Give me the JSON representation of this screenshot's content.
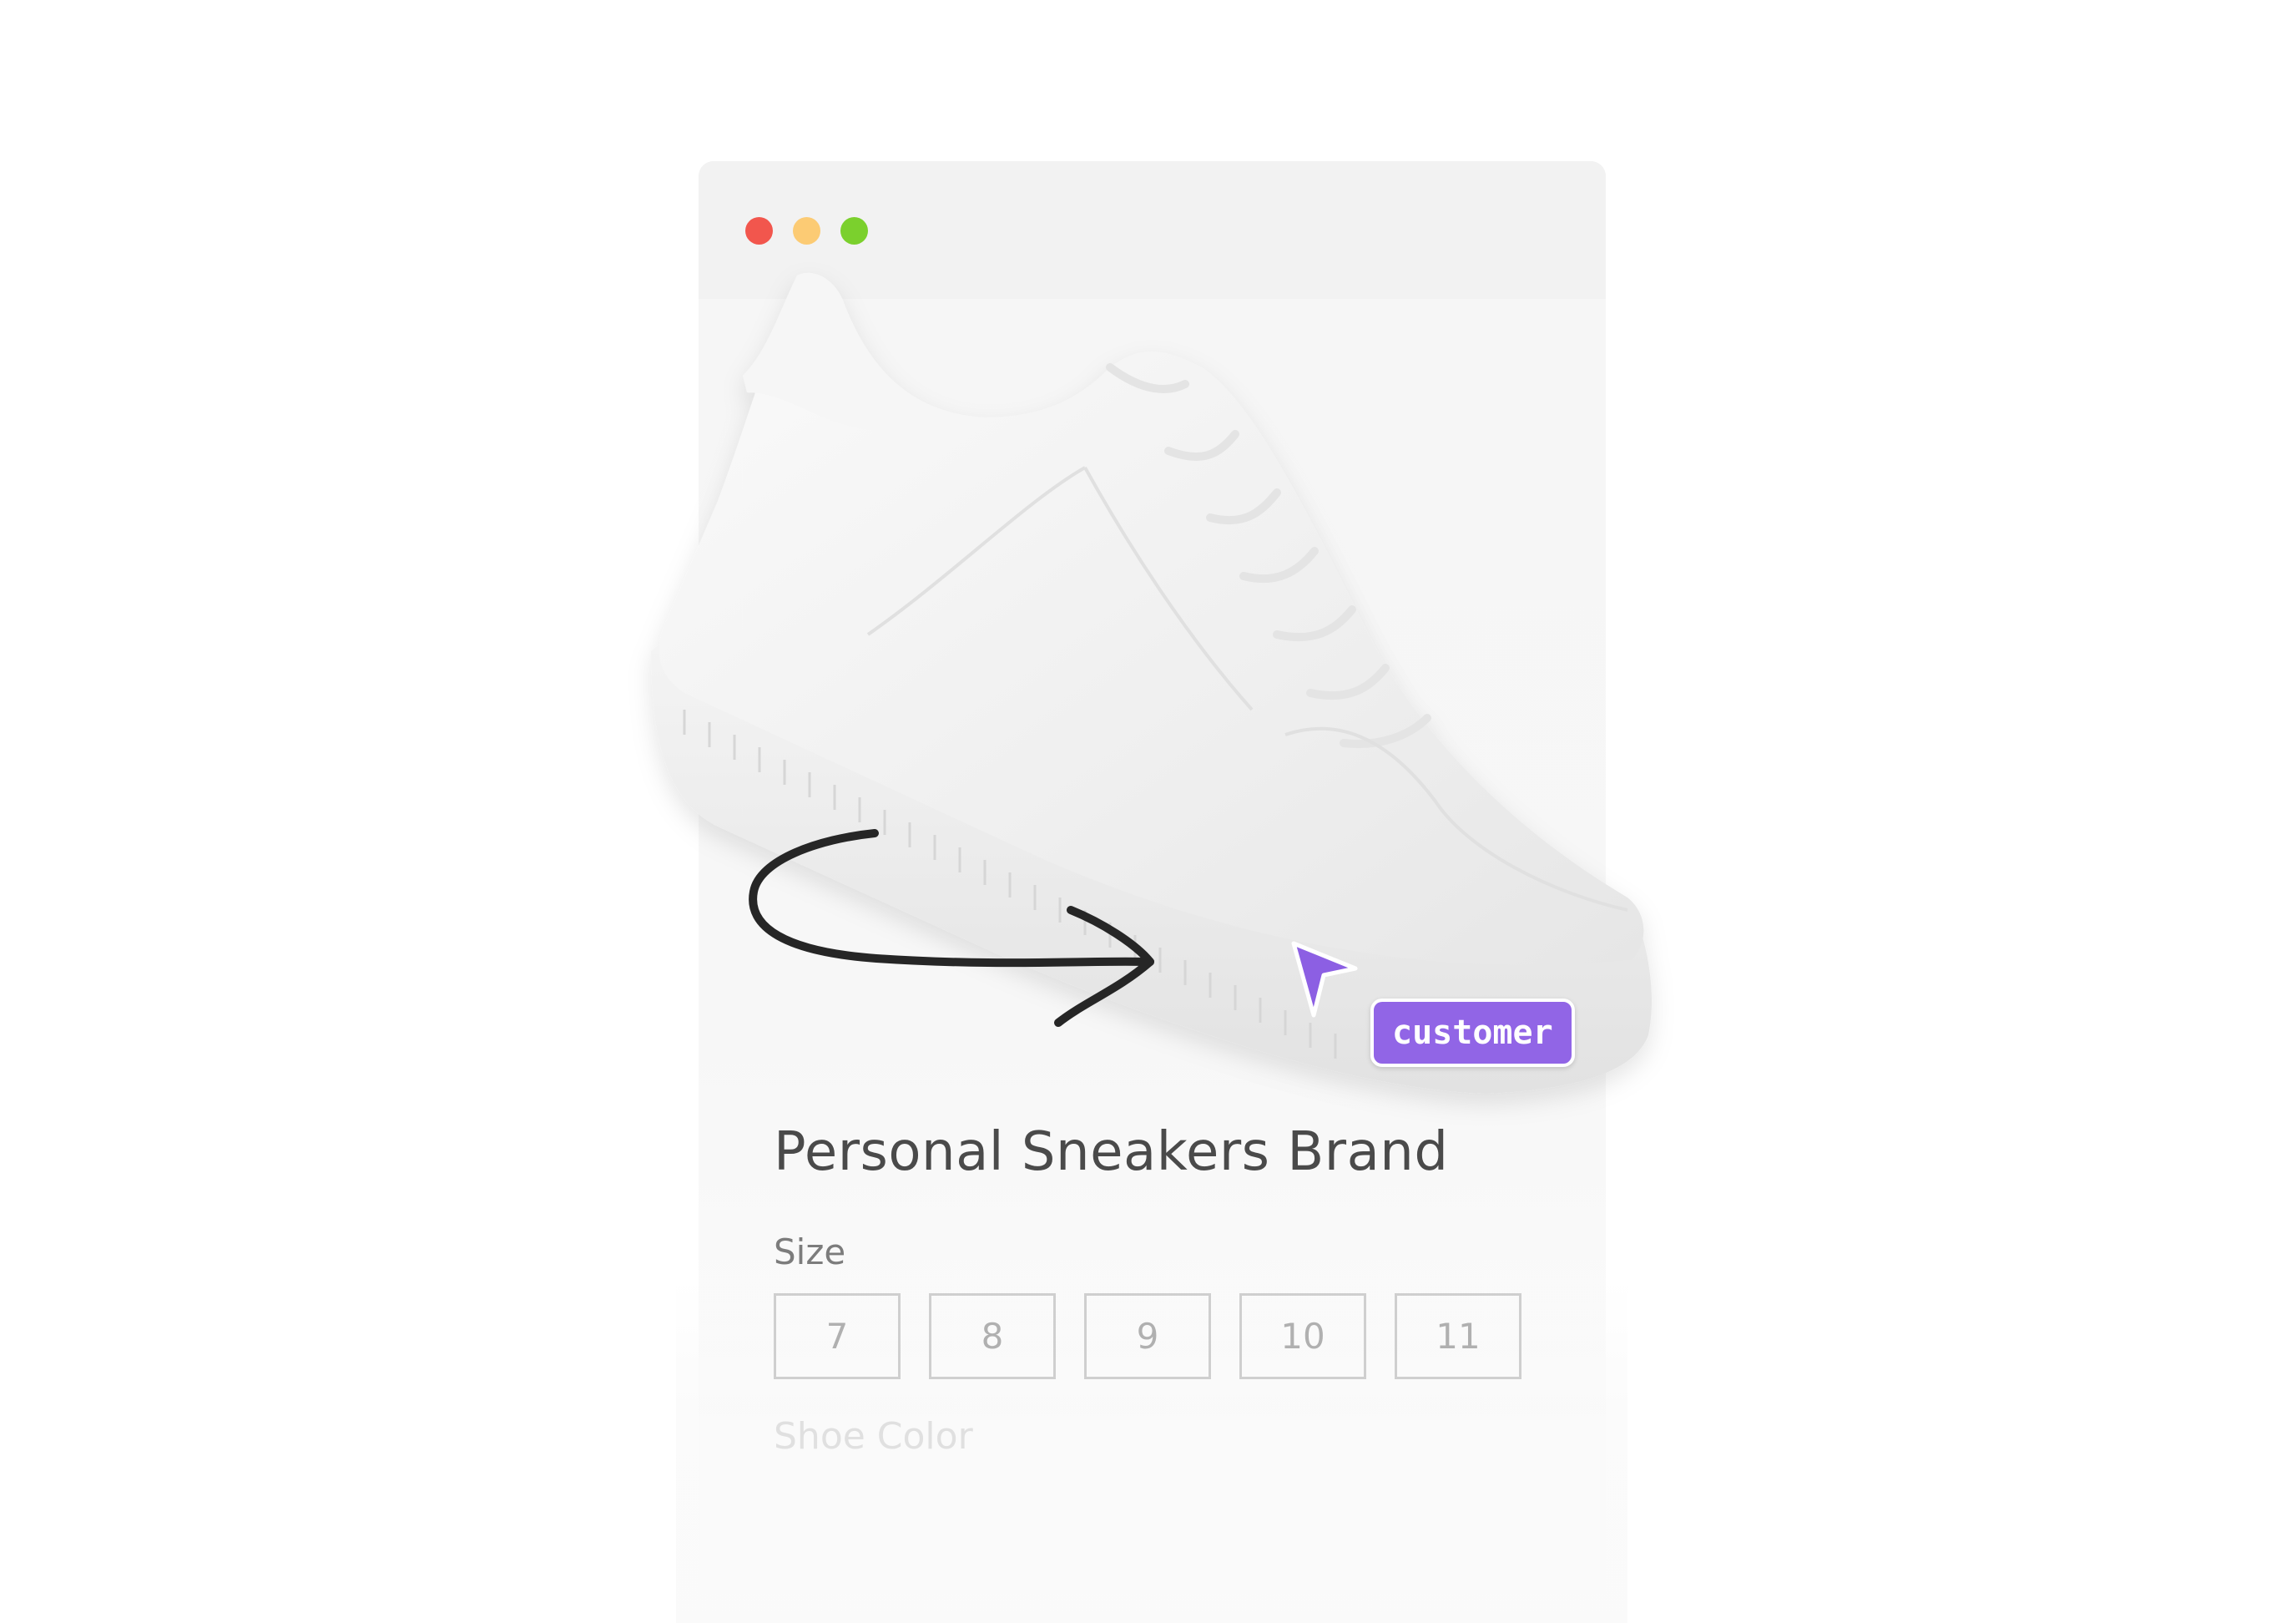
{
  "window": {
    "controls": {
      "close_color": "#f2564d",
      "minimize_color": "#fccb74",
      "maximize_color": "#7bd02d"
    }
  },
  "product": {
    "title": "Personal Sneakers Brand",
    "image_icon": "white-sneaker-image"
  },
  "size": {
    "label": "Size",
    "options": [
      "7",
      "8",
      "9",
      "10",
      "11"
    ]
  },
  "color": {
    "label": "Shoe Color"
  },
  "annotation": {
    "cursor_icon": "pointer-arrow-icon",
    "cursor_color": "#8c5fe3",
    "tag_label": "customer",
    "tag_color": "#9165e6",
    "arrow_icon": "hand-drawn-arrow-icon",
    "arrow_color": "#262626"
  }
}
